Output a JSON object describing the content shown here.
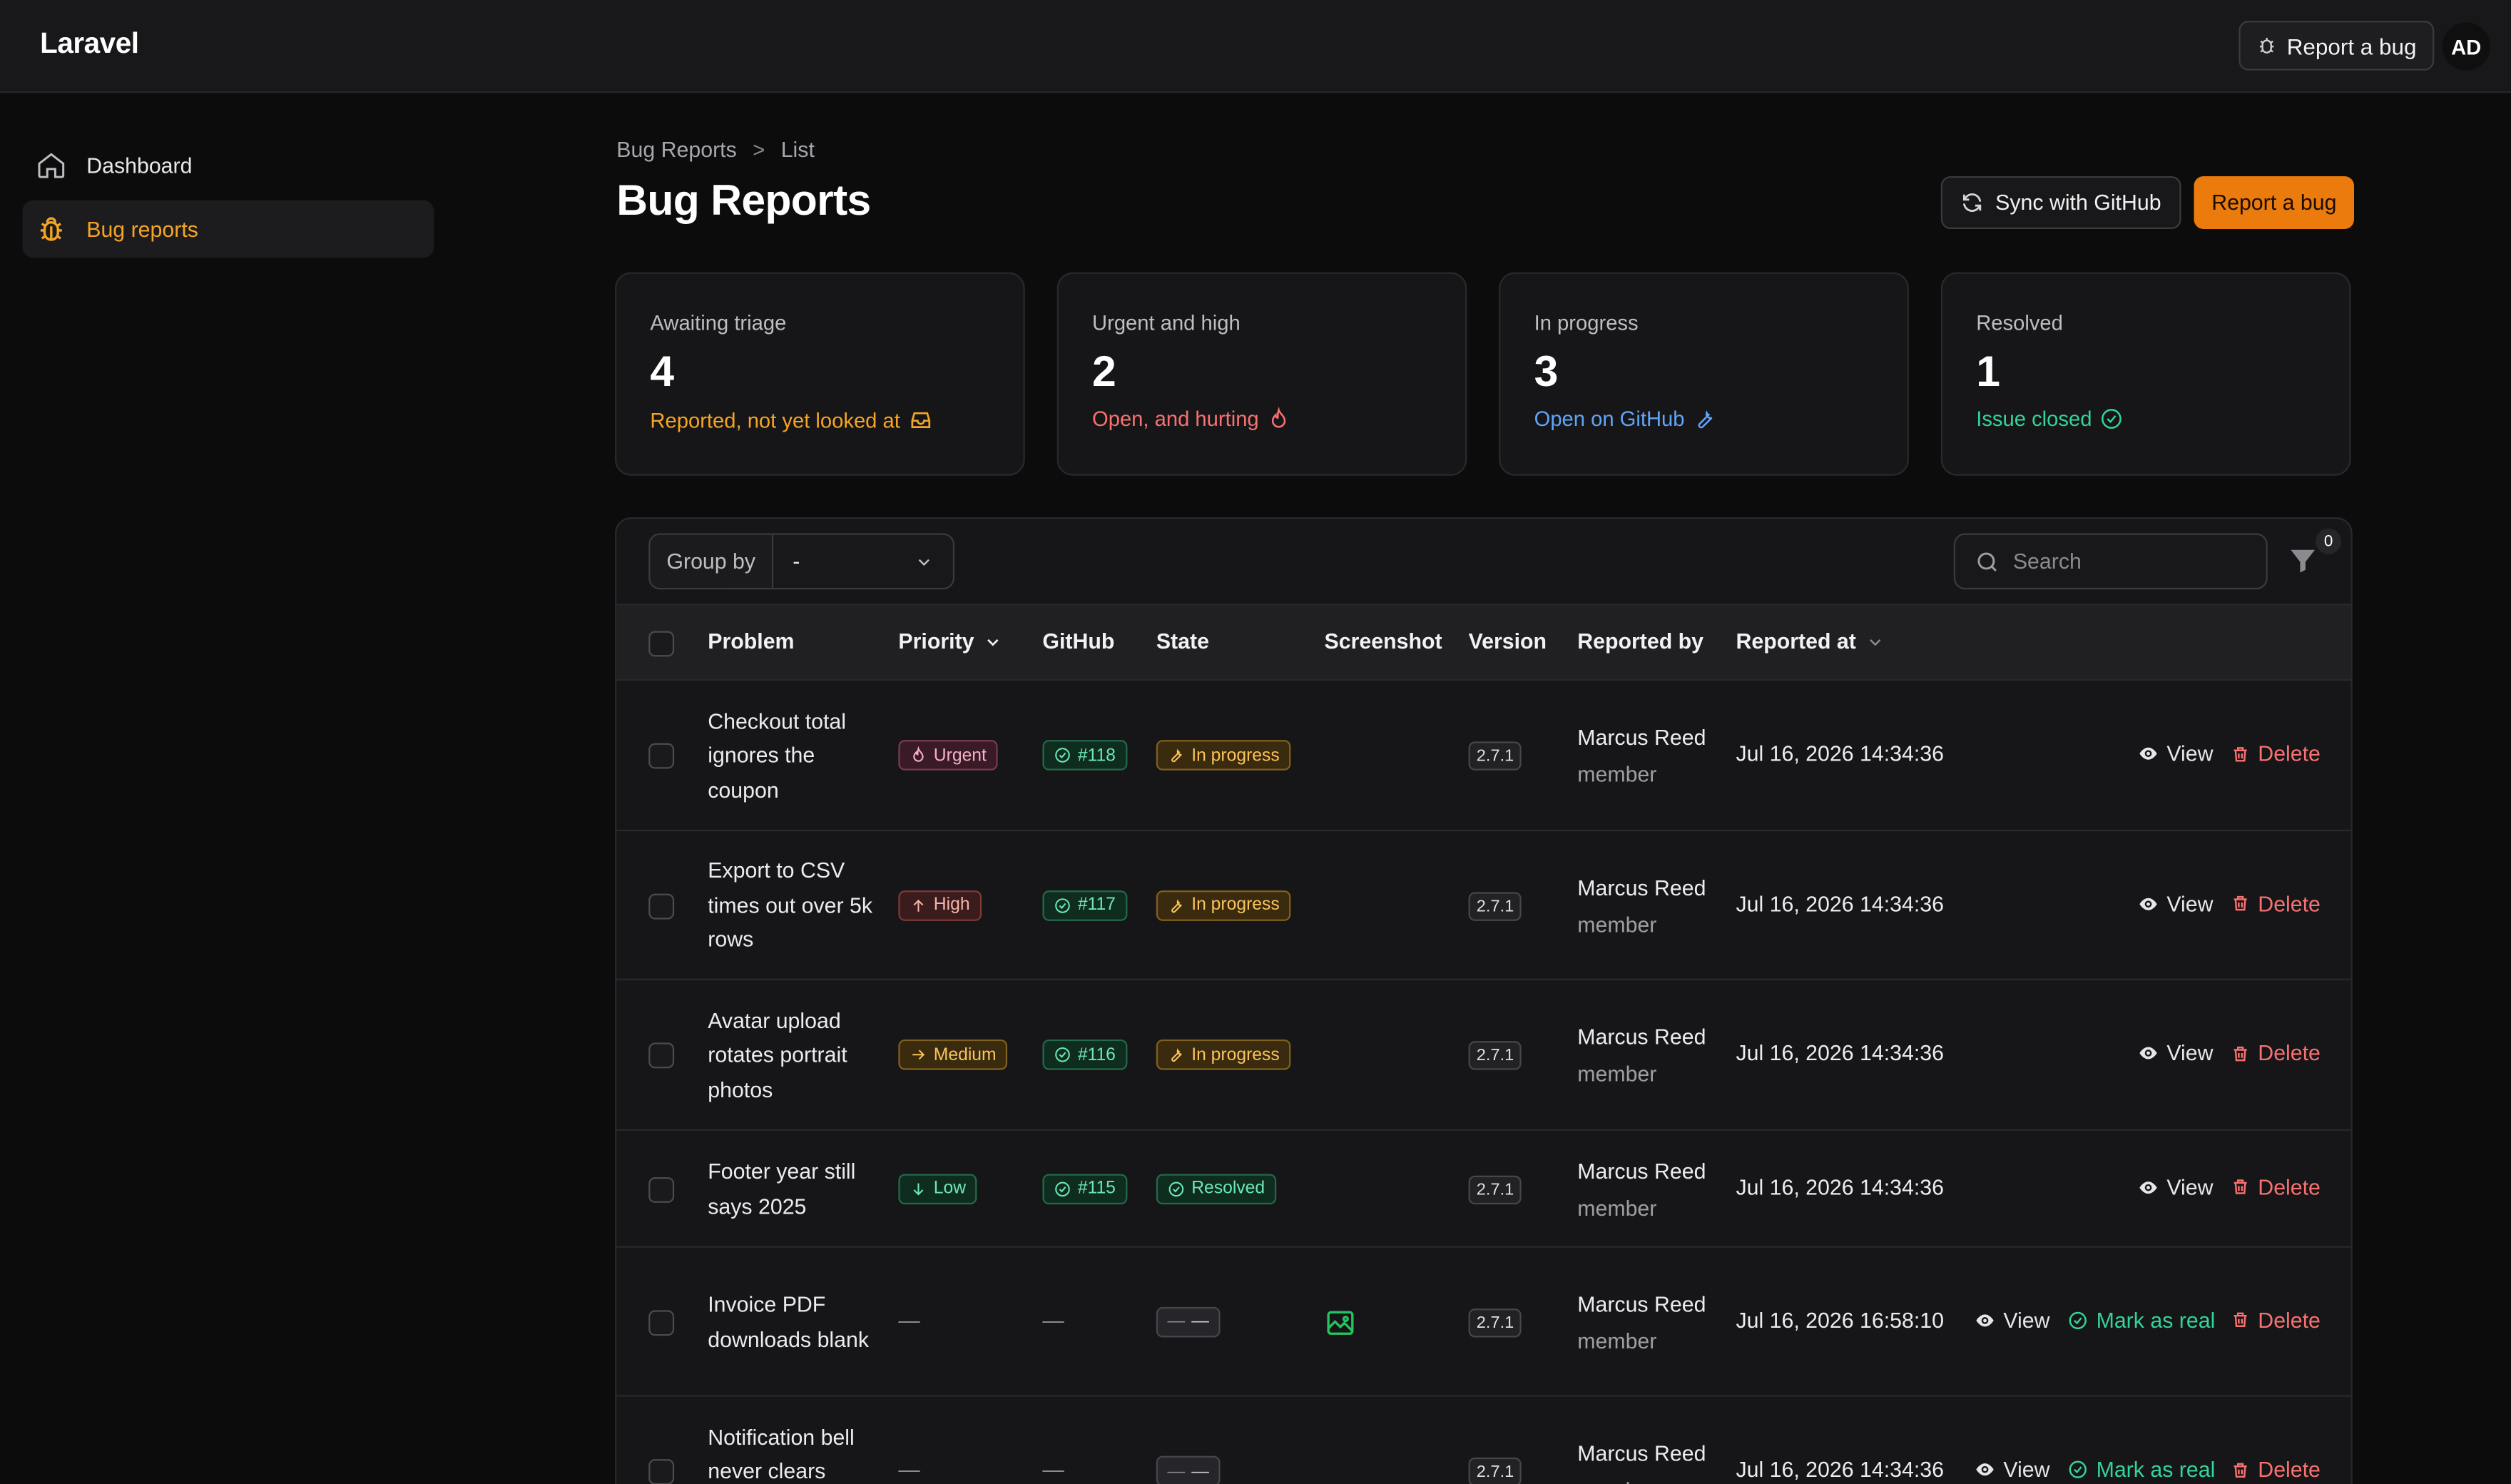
{
  "app": {
    "brand": "Laravel",
    "report_bug": "Report a bug",
    "avatar": "AD"
  },
  "sidebar": {
    "items": [
      {
        "label": "Dashboard",
        "icon": "home-icon"
      },
      {
        "label": "Bug reports",
        "icon": "bug-icon",
        "active": true
      }
    ]
  },
  "breadcrumb": {
    "items": [
      "Bug Reports",
      "List"
    ],
    "separator": ">"
  },
  "page": {
    "title": "Bug Reports",
    "sync_label": "Sync with GitHub",
    "report_label": "Report a bug"
  },
  "stats": [
    {
      "label": "Awaiting triage",
      "value": "4",
      "desc": "Reported, not yet looked at",
      "color": "#f5a524",
      "icon": "inbox-icon"
    },
    {
      "label": "Urgent and high",
      "value": "2",
      "desc": "Open, and hurting",
      "color": "#f87171",
      "icon": "fire-icon"
    },
    {
      "label": "In progress",
      "value": "3",
      "desc": "Open on GitHub",
      "color": "#60a5fa",
      "icon": "wrench-icon"
    },
    {
      "label": "Resolved",
      "value": "1",
      "desc": "Issue closed",
      "color": "#34d399",
      "icon": "check-circle-icon"
    }
  ],
  "toolbar": {
    "group_by_label": "Group by",
    "group_by_value": "-",
    "search_placeholder": "Search",
    "filter_count": "0"
  },
  "columns": [
    "Problem",
    "Priority",
    "GitHub",
    "State",
    "Screenshot",
    "Version",
    "Reported by",
    "Reported at"
  ],
  "rows": [
    {
      "problem": "Checkout total ignores the coupon",
      "priority": "Urgent",
      "github": "#118",
      "state": "In progress",
      "screenshot": false,
      "version": "2.7.1",
      "reporter": "Marcus Reed",
      "role": "member",
      "date": "Jul 16, 2026 14:34:36",
      "actions": [
        "View",
        "Delete"
      ]
    },
    {
      "problem": "Export to CSV times out over 5k rows",
      "priority": "High",
      "github": "#117",
      "state": "In progress",
      "screenshot": false,
      "version": "2.7.1",
      "reporter": "Marcus Reed",
      "role": "member",
      "date": "Jul 16, 2026 14:34:36",
      "actions": [
        "View",
        "Delete"
      ]
    },
    {
      "problem": "Avatar upload rotates portrait photos",
      "priority": "Medium",
      "github": "#116",
      "state": "In progress",
      "screenshot": false,
      "version": "2.7.1",
      "reporter": "Marcus Reed",
      "role": "member",
      "date": "Jul 16, 2026 14:34:36",
      "actions": [
        "View",
        "Delete"
      ]
    },
    {
      "problem": "Footer year still says 2025",
      "priority": "Low",
      "github": "#115",
      "state": "Resolved",
      "screenshot": false,
      "version": "2.7.1",
      "reporter": "Marcus Reed",
      "role": "member",
      "date": "Jul 16, 2026 14:34:36",
      "actions": [
        "View",
        "Delete"
      ]
    },
    {
      "problem": "Invoice PDF downloads blank",
      "priority": "—",
      "github": "—",
      "state": "—",
      "screenshot": true,
      "version": "2.7.1",
      "reporter": "Marcus Reed",
      "role": "member",
      "date": "Jul 16, 2026 16:58:10",
      "actions": [
        "View",
        "Mark as real",
        "Delete"
      ]
    },
    {
      "problem": "Notification bell never clears",
      "priority": "—",
      "github": "—",
      "state": "—",
      "screenshot": false,
      "version": "2.7.1",
      "reporter": "Marcus Reed",
      "role": "member",
      "date": "Jul 16, 2026 14:34:36",
      "actions": [
        "View",
        "Mark as real",
        "Delete"
      ]
    }
  ]
}
